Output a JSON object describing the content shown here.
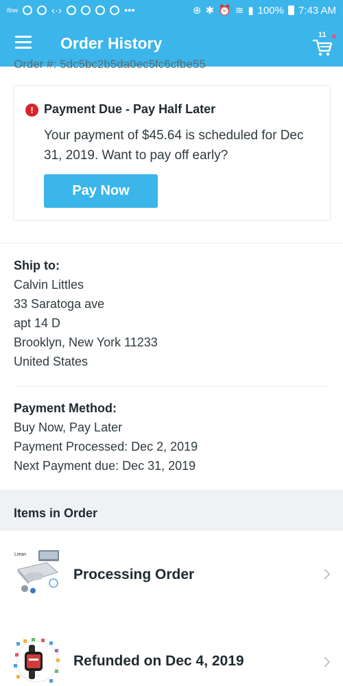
{
  "status_bar": {
    "battery": "100%",
    "time": "7:43 AM",
    "app_hint": "flow",
    "more": "•••"
  },
  "app_bar": {
    "title": "Order History",
    "cart_count": "11"
  },
  "order": {
    "number_partial": "Order #: 5dc5bc2b5da0ec5fc6cfbe55"
  },
  "payment_alert": {
    "title": "Payment Due - Pay Half Later",
    "message": "Your payment of $45.64 is scheduled for Dec 31, 2019. Want to pay off early?",
    "button_label": "Pay Now"
  },
  "ship_to": {
    "title": "Ship to:",
    "lines": [
      "Calvin Littles",
      "33 Saratoga ave",
      "apt 14 D",
      "Brooklyn, New York 11233",
      "United States"
    ]
  },
  "payment_method": {
    "title": "Payment Method:",
    "lines": [
      "Buy Now, Pay Later",
      "Payment Processed: Dec 2, 2019",
      "Next Payment due: Dec 31, 2019"
    ]
  },
  "items": {
    "header": "Items in Order",
    "list": [
      {
        "status": "Processing Order",
        "thumb_text": "Liean"
      },
      {
        "status": "Refunded on Dec 4, 2019"
      }
    ]
  },
  "colors": {
    "brand": "#3bb5ea",
    "alert": "#d8232a",
    "section_bg": "#eef2f5"
  }
}
